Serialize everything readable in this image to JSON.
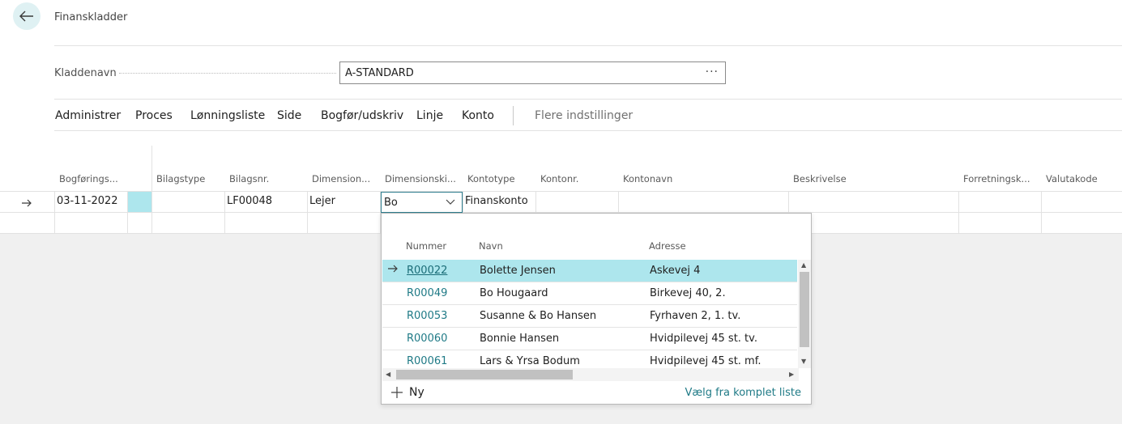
{
  "header": {
    "title": "Finanskladder"
  },
  "journal": {
    "label": "Kladdenavn",
    "value": "A-STANDARD",
    "more": "···"
  },
  "actions": {
    "items": [
      "Administrer",
      "Proces",
      "Lønningsliste",
      "Side",
      "Bogfør/udskriv",
      "Linje",
      "Konto"
    ],
    "more": "Flere indstillinger"
  },
  "grid": {
    "columns": [
      "Bogførings...",
      "Bilagstype",
      "Bilagsnr.",
      "Dimension...",
      "Dimensionski...",
      "Kontotype",
      "Kontonr.",
      "Kontonavn",
      "Beskrivelse",
      "Forretningsk...",
      "Valutakode"
    ],
    "row": {
      "date": "03-11-2022",
      "doc_no": "LF00048",
      "dimension": "Lejer",
      "dimension_code": "Bo",
      "account_type": "Finanskonto"
    }
  },
  "dropdown": {
    "headers": {
      "number": "Nummer",
      "name": "Navn",
      "address": "Adresse"
    },
    "rows": [
      {
        "number": "R00022",
        "name": "Bolette Jensen",
        "address": "Askevej 4"
      },
      {
        "number": "R00049",
        "name": "Bo Hougaard",
        "address": "Birkevej 40, 2."
      },
      {
        "number": "R00053",
        "name": "Susanne & Bo Hansen",
        "address": "Fyrhaven 2, 1. tv."
      },
      {
        "number": "R00060",
        "name": "Bonnie Hansen",
        "address": "Hvidpilevej 45 st. tv."
      },
      {
        "number": "R00061",
        "name": "Lars & Yrsa Bodum",
        "address": "Hvidpilevej 45 st. mf."
      }
    ],
    "selected_index": 0,
    "new_label": "Ny",
    "full_list_label": "Vælg fra komplet liste"
  },
  "colors": {
    "accent": "#1f7a86",
    "selected_row": "#ade6ed",
    "back_button": "#dff1f3"
  },
  "icons": {
    "back": "arrow-left-icon",
    "row_indicator": "arrow-right-icon",
    "dropdown": "chevron-down-icon",
    "new": "plus-icon"
  }
}
